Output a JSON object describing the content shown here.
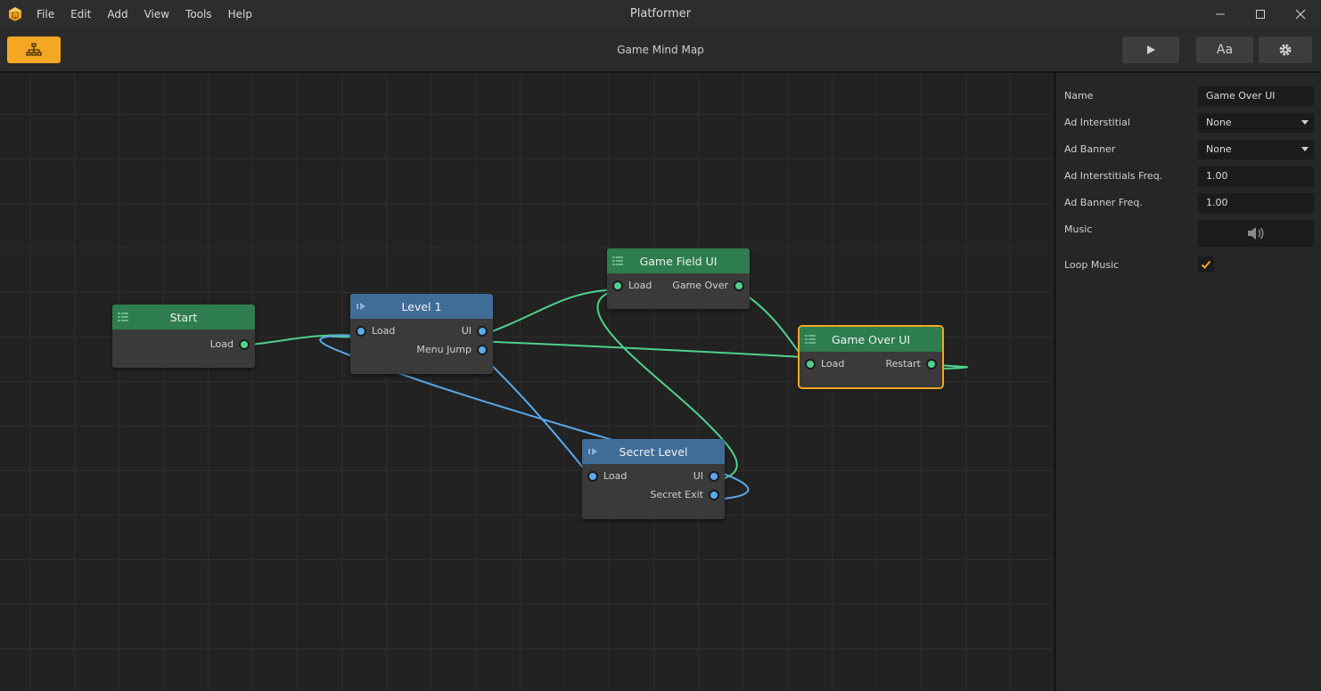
{
  "app": {
    "title": "Platformer"
  },
  "menu": [
    "File",
    "Edit",
    "Add",
    "View",
    "Tools",
    "Help"
  ],
  "toolbar": {
    "title": "Game Mind Map",
    "font_label": "Aa"
  },
  "colors": {
    "accent": "#f5a623",
    "node_green": "#2e7d4f",
    "node_blue": "#3f6d98",
    "link_green": "#4fd18b",
    "link_blue": "#5aa9ec"
  },
  "nodes": {
    "start": {
      "title": "Start",
      "ports": {
        "load": "Load"
      }
    },
    "level1": {
      "title": "Level 1",
      "ports": {
        "load": "Load",
        "ui": "UI",
        "menu_jump": "Menu Jump"
      }
    },
    "game_field_ui": {
      "title": "Game Field UI",
      "ports": {
        "load": "Load",
        "game_over": "Game Over"
      }
    },
    "game_over_ui": {
      "title": "Game Over UI",
      "ports": {
        "load": "Load",
        "restart": "Restart"
      }
    },
    "secret_level": {
      "title": "Secret Level",
      "ports": {
        "load": "Load",
        "ui": "UI",
        "secret_exit": "Secret Exit"
      }
    }
  },
  "inspector": {
    "name": {
      "label": "Name",
      "value": "Game Over UI"
    },
    "ad_interstitial": {
      "label": "Ad Interstitial",
      "value": "None"
    },
    "ad_banner": {
      "label": "Ad Banner",
      "value": "None"
    },
    "ad_interstitials_freq": {
      "label": "Ad Interstitials Freq.",
      "value": "1.00"
    },
    "ad_banner_freq": {
      "label": "Ad Banner Freq.",
      "value": "1.00"
    },
    "music": {
      "label": "Music",
      "icon": "speaker-icon"
    },
    "loop_music": {
      "label": "Loop Music",
      "checked": true
    }
  }
}
